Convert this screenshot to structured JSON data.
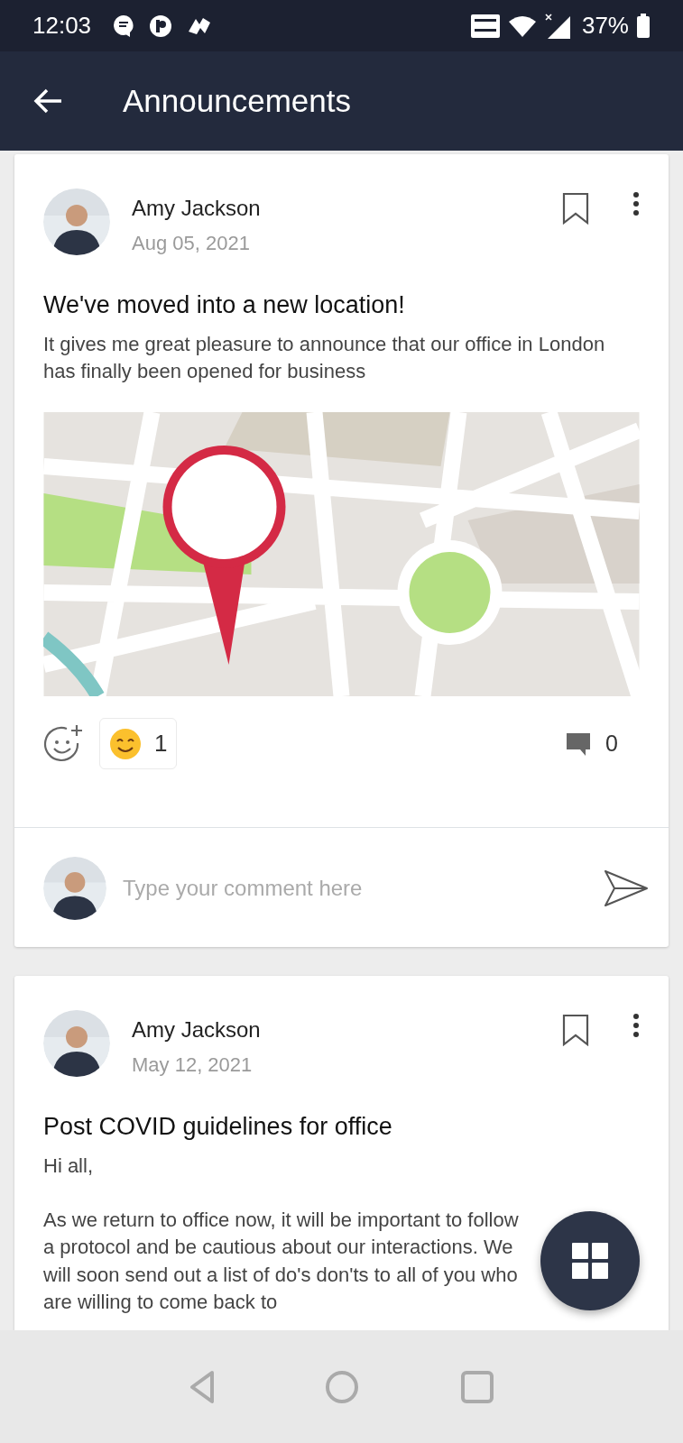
{
  "status_bar": {
    "time": "12:03",
    "battery": "37%"
  },
  "app_bar": {
    "title": "Announcements"
  },
  "posts": [
    {
      "author": "Amy Jackson",
      "date": "Aug 05, 2021",
      "bookmarked": false,
      "title": "We've moved into a new location!",
      "paragraphs": [
        "It gives me great pleasure to announce that our office in London has finally been opened for business"
      ],
      "image": {
        "kind": "picture"
      },
      "reactions": [
        {
          "count": "1"
        }
      ],
      "comment_count": "0",
      "comment_placeholder": "Type your comment here"
    },
    {
      "author": "Amy Jackson",
      "date": "May 12, 2021",
      "bookmarked": false,
      "title": "Post COVID guidelines for office",
      "paragraphs": [
        "Hi all,",
        "As we return to office now, it will be important to follow a protocol and be cautious about our interactions. We will soon send out a list of do's don'ts to all of you who are willing to come back to"
      ]
    }
  ]
}
